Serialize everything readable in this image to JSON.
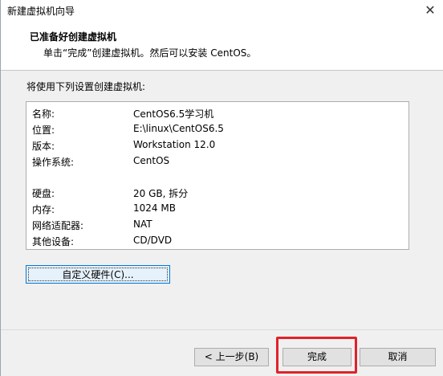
{
  "window": {
    "title": "新建虚拟机向导",
    "close_glyph": "✕"
  },
  "header": {
    "title": "已准备好创建虚拟机",
    "subtitle": "单击“完成”创建虚拟机。然后可以安装 CentOS。"
  },
  "body": {
    "label": "将使用下列设置创建虚拟机:"
  },
  "summary": {
    "rows": [
      {
        "key": "名称:",
        "value": "CentOS6.5学习机"
      },
      {
        "key": "位置:",
        "value": "E:\\linux\\CentOS6.5"
      },
      {
        "key": "版本:",
        "value": "Workstation 12.0"
      },
      {
        "key": "操作系统:",
        "value": "CentOS"
      },
      {
        "key": "硬盘:",
        "value": "20 GB, 拆分"
      },
      {
        "key": "内存:",
        "value": "1024 MB"
      },
      {
        "key": "网络适配器:",
        "value": "NAT"
      },
      {
        "key": "其他设备:",
        "value": "CD/DVD"
      }
    ]
  },
  "buttons": {
    "customize": "自定义硬件(C)...",
    "back": "< 上一步(B)",
    "finish": "完成",
    "cancel": "取消"
  },
  "colors": {
    "highlight": "#e0222a",
    "focus": "#0078d7"
  }
}
